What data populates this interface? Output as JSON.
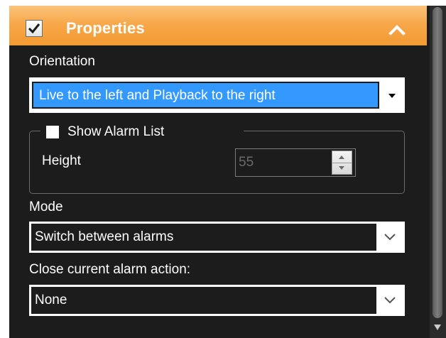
{
  "header": {
    "title": "Properties",
    "checked": true,
    "collapse_icon": "chevron-up-icon"
  },
  "orientation": {
    "label": "Orientation",
    "selected": "Live to the left and Playback to the right"
  },
  "alarm_list": {
    "checkbox_label": "Show Alarm List",
    "checked": false,
    "height_label": "Height",
    "height_value": "55"
  },
  "mode": {
    "label": "Mode",
    "selected": "Switch between alarms"
  },
  "close_action": {
    "label": "Close current alarm action:",
    "selected": "None"
  },
  "colors": {
    "header_orange": "#f7a84a",
    "panel_bg": "#1c1c1c",
    "selection_blue": "#3399ff"
  }
}
